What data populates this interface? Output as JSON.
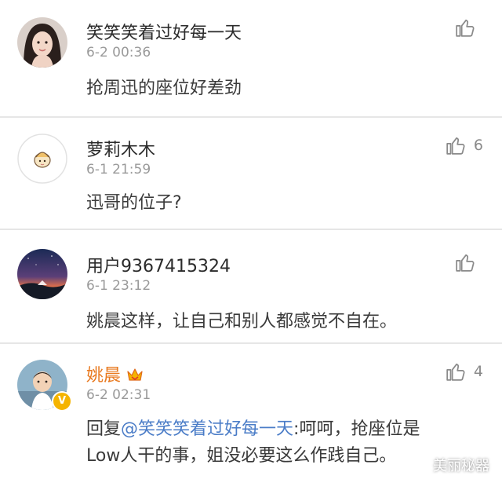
{
  "comments": [
    {
      "username": "笑笑笑着过好每一天",
      "time": "6-2 00:36",
      "text": "抢周迅的座位好差劲",
      "likes": ""
    },
    {
      "username": "萝莉木木",
      "time": "6-1 21:59",
      "text": "迅哥的位子?",
      "likes": "6"
    },
    {
      "username": "用户9367415324",
      "time": "6-1 23:12",
      "text": "姚晨这样，让自己和别人都感觉不自在。",
      "likes": ""
    },
    {
      "username": "姚晨",
      "time": "6-2 02:31",
      "reply_prefix": "回复",
      "mention": "@笑笑笑着过好每一天",
      "text_line1": ":呵呵，抢座位是",
      "text_line2": "Low人干的事，姐没必要这么作践自己。",
      "likes": "4",
      "verified_badge": "V"
    }
  ],
  "watermark": {
    "text": "美丽秘器",
    "icon": "wechat-icon"
  },
  "colors": {
    "vip_name": "#e8791f",
    "mention": "#4a7cc7",
    "verified": "#f5b400",
    "time": "#9a9a9a",
    "divider": "#e6e6e6"
  }
}
